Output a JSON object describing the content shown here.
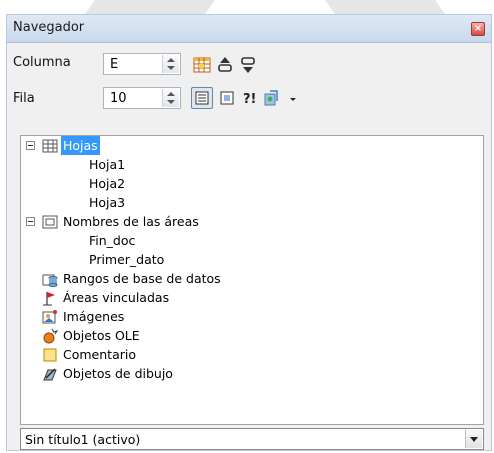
{
  "window": {
    "title": "Navegador",
    "close_label": "×"
  },
  "controls": {
    "column": {
      "label": "Columna",
      "value": "E"
    },
    "row": {
      "label": "Fila",
      "value": "10"
    }
  },
  "tree": {
    "sheets": {
      "label": "Hojas",
      "items": [
        "Hoja1",
        "Hoja2",
        "Hoja3"
      ]
    },
    "ranges": {
      "label": "Nombres de las áreas",
      "items": [
        "Fin_doc",
        "Primer_dato"
      ]
    },
    "database_ranges": "Rangos de base de datos",
    "linked_areas": "Áreas vinculadas",
    "images": "Imágenes",
    "ole_objects": "Objetos OLE",
    "comment": "Comentario",
    "drawing_objects": "Objetos de dibujo"
  },
  "document_select": {
    "value": "Sin título1 (activo)"
  },
  "colors": {
    "selection": "#3399ff",
    "titlebar": "#c9d9ec"
  }
}
